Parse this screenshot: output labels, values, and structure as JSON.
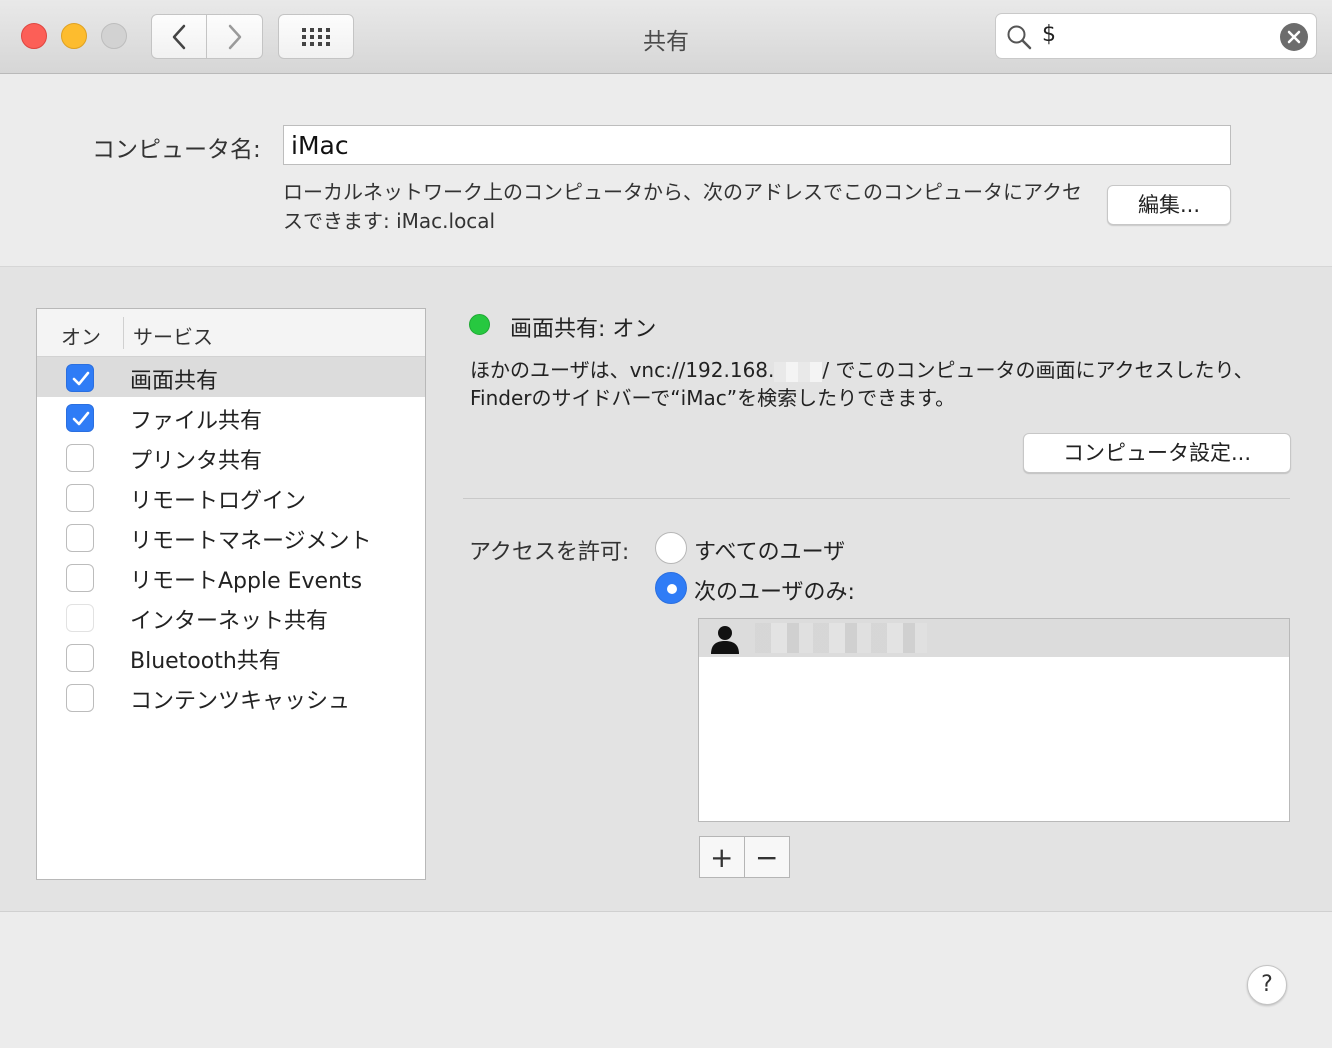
{
  "window": {
    "title": "共有",
    "search_value": "$"
  },
  "computer": {
    "name_label": "コンピュータ名:",
    "name_value": "iMac",
    "address_text": "ローカルネットワーク上のコンピュータから、次のアドレスでこのコンピュータにアクセスできます: iMac.local",
    "edit_button": "編集..."
  },
  "services": {
    "header_on": "オン",
    "header_service": "サービス",
    "items": [
      {
        "label": "画面共有",
        "checked": true,
        "selected": true,
        "disabled": false
      },
      {
        "label": "ファイル共有",
        "checked": true,
        "selected": false,
        "disabled": false
      },
      {
        "label": "プリンタ共有",
        "checked": false,
        "selected": false,
        "disabled": false
      },
      {
        "label": "リモートログイン",
        "checked": false,
        "selected": false,
        "disabled": false
      },
      {
        "label": "リモートマネージメント",
        "checked": false,
        "selected": false,
        "disabled": false
      },
      {
        "label": "リモートApple Events",
        "checked": false,
        "selected": false,
        "disabled": false
      },
      {
        "label": "インターネット共有",
        "checked": false,
        "selected": false,
        "disabled": true
      },
      {
        "label": "Bluetooth共有",
        "checked": false,
        "selected": false,
        "disabled": false
      },
      {
        "label": "コンテンツキャッシュ",
        "checked": false,
        "selected": false,
        "disabled": false
      }
    ]
  },
  "detail": {
    "status_text": "画面共有: オン",
    "status_color": "#27c840",
    "desc_part1": "ほかのユーザは、vnc://192.168.",
    "desc_part2": "/ でこのコンピュータの画面にアクセスしたり、Finderのサイドバーで“iMac”を検索したりできます。",
    "computer_settings_button": "コンピュータ設定...",
    "access_label": "アクセスを許可:",
    "radio_all_label": "すべてのユーザ",
    "radio_only_label": "次のユーザのみ:",
    "radio_selected": "only",
    "plus_label": "+",
    "minus_label": "−"
  },
  "help_label": "?",
  "accent_color": "#2f7cf6"
}
